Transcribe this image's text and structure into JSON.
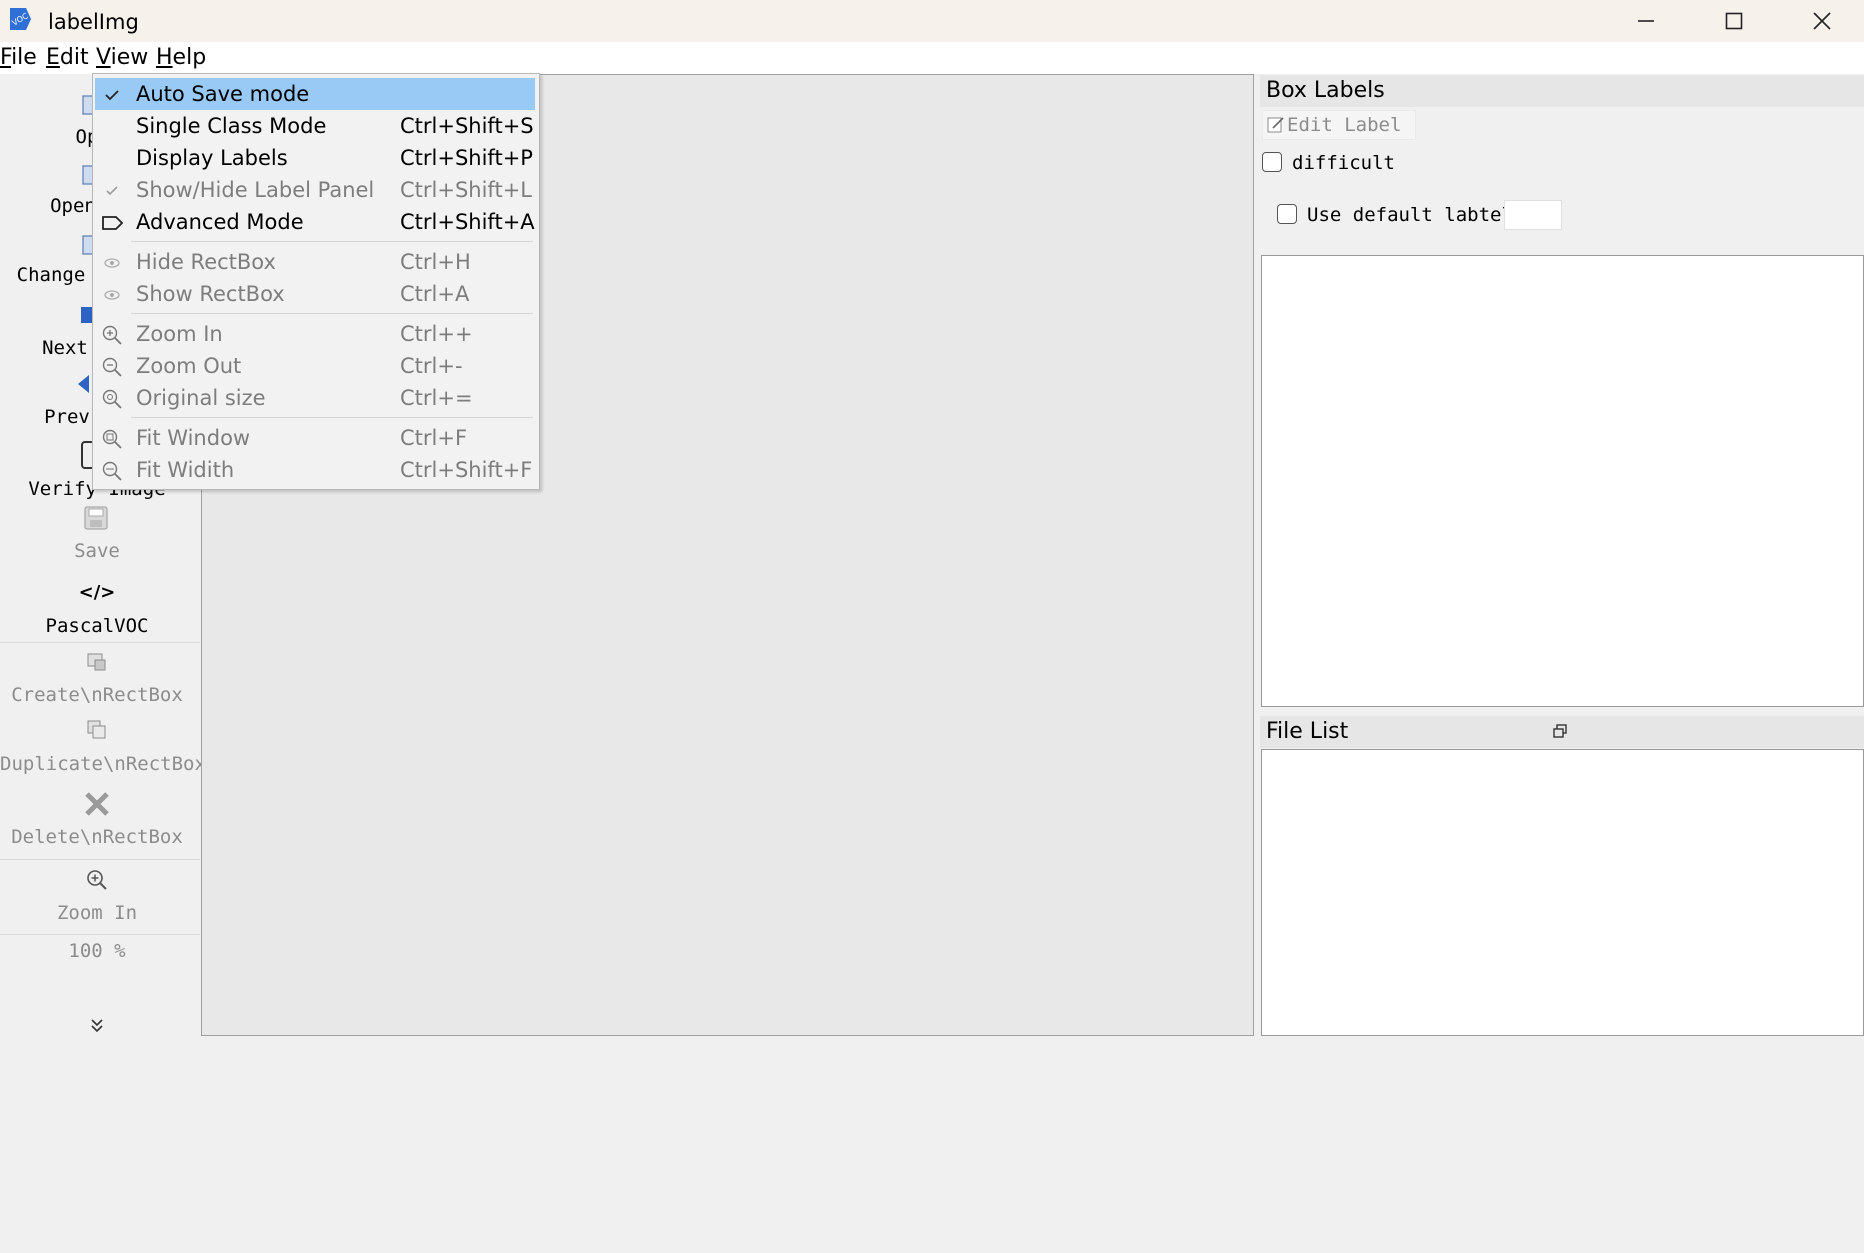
{
  "window": {
    "title": "labelImg",
    "app_icon_text": "VOC"
  },
  "menubar": {
    "items": [
      "File",
      "Edit",
      "View",
      "Help"
    ]
  },
  "toolbar": {
    "items": [
      {
        "label": "Op",
        "enabled": true
      },
      {
        "label": "Open",
        "enabled": true
      },
      {
        "label": "Change",
        "enabled": true
      },
      {
        "label": "Next",
        "enabled": true
      },
      {
        "label": "Prev",
        "enabled": true
      },
      {
        "label": "Verify Image",
        "enabled": true
      },
      {
        "label": "Save",
        "enabled": false
      },
      {
        "label": "PascalVOC",
        "enabled": true
      },
      {
        "label": "Create\\nRectBox",
        "enabled": false
      },
      {
        "label": "Duplicate\\nRectBox",
        "enabled": false
      },
      {
        "label": "Delete\\nRectBox",
        "enabled": false
      },
      {
        "label": "Zoom In",
        "enabled": false
      },
      {
        "label": "100 %",
        "enabled": false
      }
    ],
    "format_icon_text": "</>",
    "more_icon": "chevron-double-down-icon"
  },
  "view_menu": {
    "items": [
      {
        "label": "Auto Save mode",
        "shortcut": "",
        "icon": "check-icon",
        "enabled": true,
        "highlighted": true
      },
      {
        "label": "Single Class Mode",
        "shortcut": "Ctrl+Shift+S",
        "icon": "",
        "enabled": true
      },
      {
        "label": "Display Labels",
        "shortcut": "Ctrl+Shift+P",
        "icon": "",
        "enabled": true
      },
      {
        "label": "Show/Hide Label Panel",
        "shortcut": "Ctrl+Shift+L",
        "icon": "check-icon",
        "enabled": false
      },
      {
        "label": "Advanced Mode",
        "shortcut": "Ctrl+Shift+A",
        "icon": "tag-icon",
        "enabled": true
      },
      {
        "label": "Hide RectBox",
        "shortcut": "Ctrl+H",
        "icon": "eye-icon",
        "enabled": false
      },
      {
        "label": "Show RectBox",
        "shortcut": "Ctrl+A",
        "icon": "eye-icon",
        "enabled": false
      },
      {
        "label": "Zoom In",
        "shortcut": "Ctrl++",
        "icon": "zoom-in-icon",
        "enabled": false
      },
      {
        "label": "Zoom Out",
        "shortcut": "Ctrl+-",
        "icon": "zoom-out-icon",
        "enabled": false
      },
      {
        "label": "Original size",
        "shortcut": "Ctrl+=",
        "icon": "zoom-original-icon",
        "enabled": false
      },
      {
        "label": "Fit Window",
        "shortcut": "Ctrl+F",
        "icon": "fit-window-icon",
        "enabled": false
      },
      {
        "label": "Fit Widith",
        "shortcut": "Ctrl+Shift+F",
        "icon": "fit-width-icon",
        "enabled": false
      }
    ]
  },
  "box_labels": {
    "title": "Box Labels",
    "edit_label_button": "Edit Label",
    "difficult_label": "difficult",
    "use_default_label": "Use default labtel",
    "difficult_checked": false,
    "use_default_checked": false
  },
  "file_list": {
    "title": "File List"
  },
  "colors": {
    "highlight": "#99c9f5",
    "disabled_text": "#7d7d7d",
    "canvas_bg": "#e8e8e8"
  }
}
